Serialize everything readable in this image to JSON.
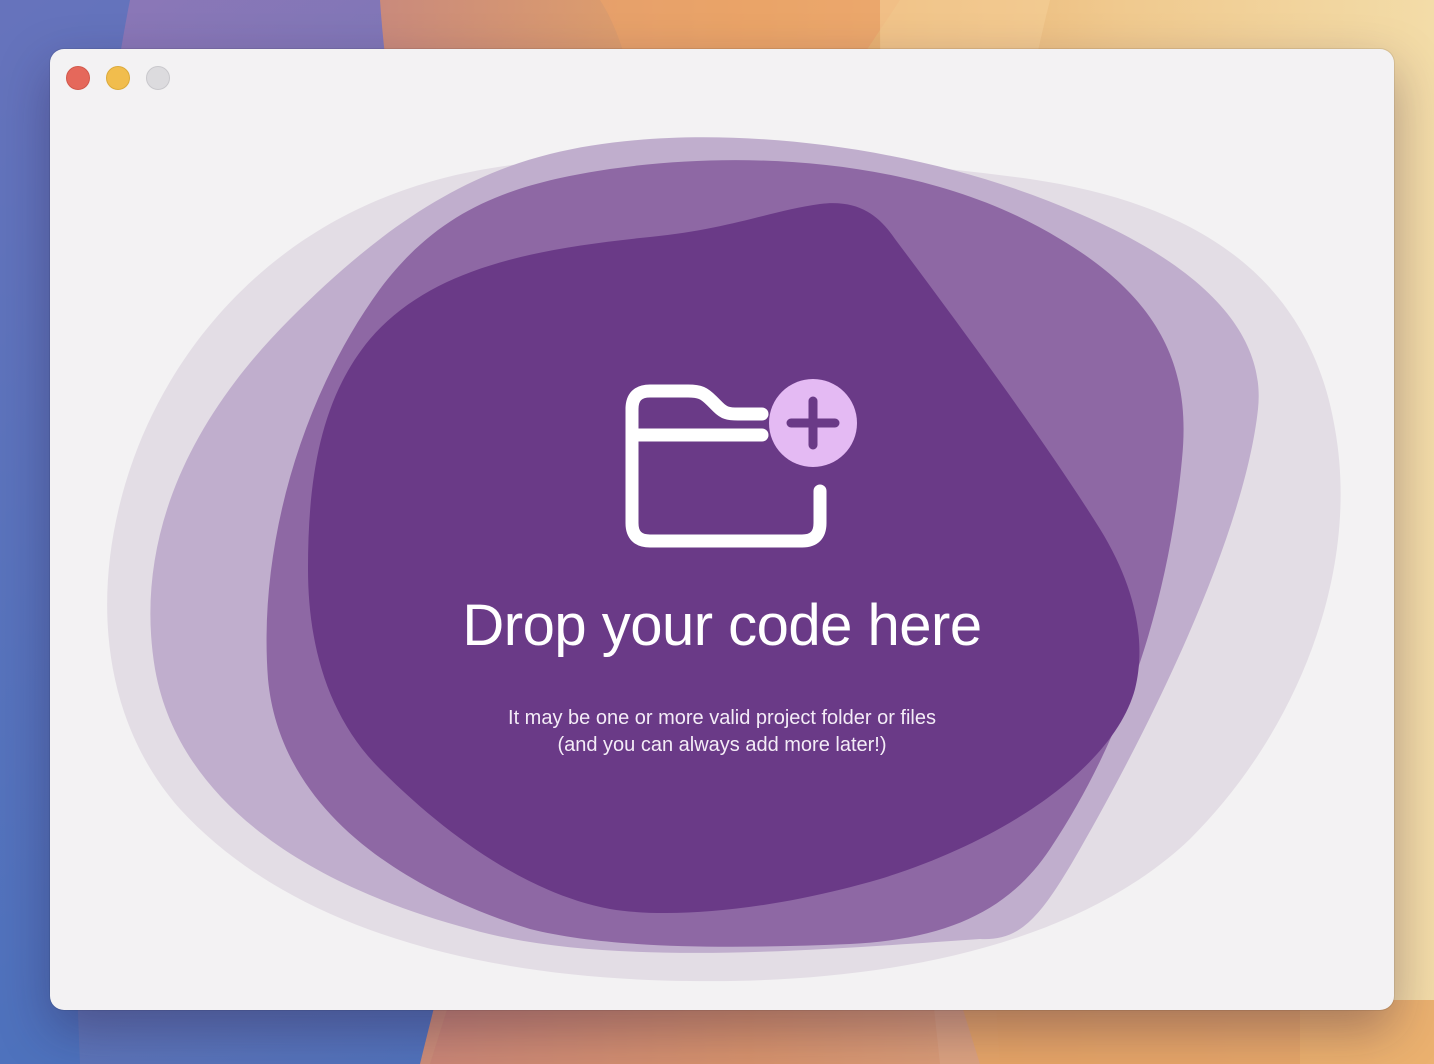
{
  "window": {
    "controls": {
      "close": "close-button",
      "minimize": "minimize-button",
      "zoom": "zoom-button"
    }
  },
  "drop_zone": {
    "icon": "folder-plus-icon",
    "title": "Drop your code here",
    "subtitle_line1": "It may be one or more valid project folder or files",
    "subtitle_line2": "(and you can always add more later!)"
  },
  "colors": {
    "accent_dark": "#6a3a87",
    "accent_mid": "#8e68a4",
    "accent_light": "#c0aecd",
    "accent_faint": "#e3dde5",
    "plus_badge": "#e4baf3",
    "window_bg": "#f3f2f3"
  }
}
